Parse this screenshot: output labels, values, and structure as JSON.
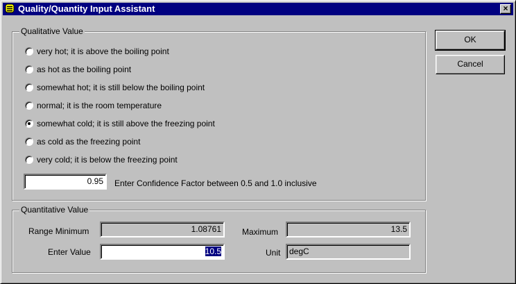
{
  "window": {
    "title": "Quality/Quantity Input Assistant",
    "icon": "app-stack-icon",
    "close_glyph": "×"
  },
  "qualitative": {
    "legend": "Qualitative Value",
    "options": [
      {
        "label": "very hot; it is above the boiling point",
        "checked": false
      },
      {
        "label": "as hot as the boiling point",
        "checked": false
      },
      {
        "label": "somewhat hot; it is still below the boiling point",
        "checked": false
      },
      {
        "label": "normal; it is the room temperature",
        "checked": false
      },
      {
        "label": "somewhat cold; it is still above the freezing point",
        "checked": true
      },
      {
        "label": "as cold as the freezing point",
        "checked": false
      },
      {
        "label": "very cold; it is below the freezing point",
        "checked": false
      }
    ],
    "confidence_value": "0.95",
    "confidence_label": "Enter Confidence Factor between 0.5 and 1.0 inclusive"
  },
  "quantitative": {
    "legend": "Quantitative Value",
    "range_min_label": "Range Minimum",
    "range_min_value": "1.08761",
    "max_label": "Maximum",
    "max_value": "13.5",
    "enter_label": "Enter Value",
    "enter_value": "10.5",
    "unit_label": "Unit",
    "unit_value": "degC"
  },
  "buttons": {
    "ok": "OK",
    "cancel": "Cancel"
  }
}
